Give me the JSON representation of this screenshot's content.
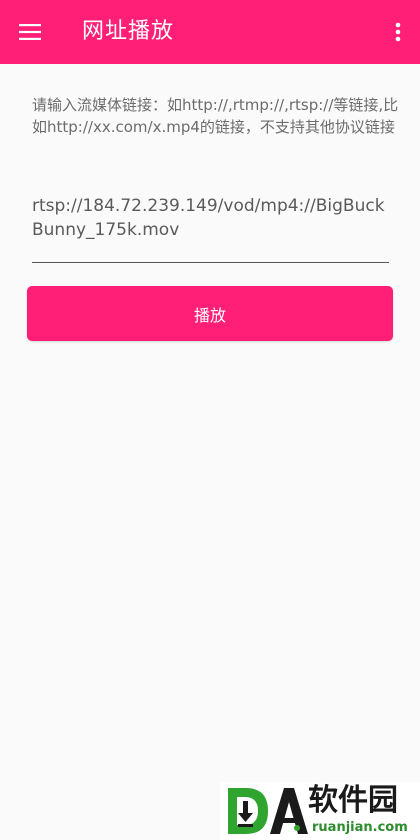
{
  "appbar": {
    "title": "网址播放",
    "menu_icon": "hamburger-menu-icon",
    "more_icon": "more-vertical-icon",
    "background_color": "#ff1f76"
  },
  "content": {
    "hint": "请输入流媒体链接：如http://,rtmp://,rtsp://等链接,比如http://xx.com/x.mp4的链接，不支持其他协议链接",
    "url_value": "rtsp://184.72.239.149/vod/mp4://BigBuckBunny_175k.mov",
    "play_label": "播放"
  },
  "watermark": {
    "brand_cn": "软件园",
    "brand_en": "ruanjian.com",
    "logo_text": "DA"
  }
}
